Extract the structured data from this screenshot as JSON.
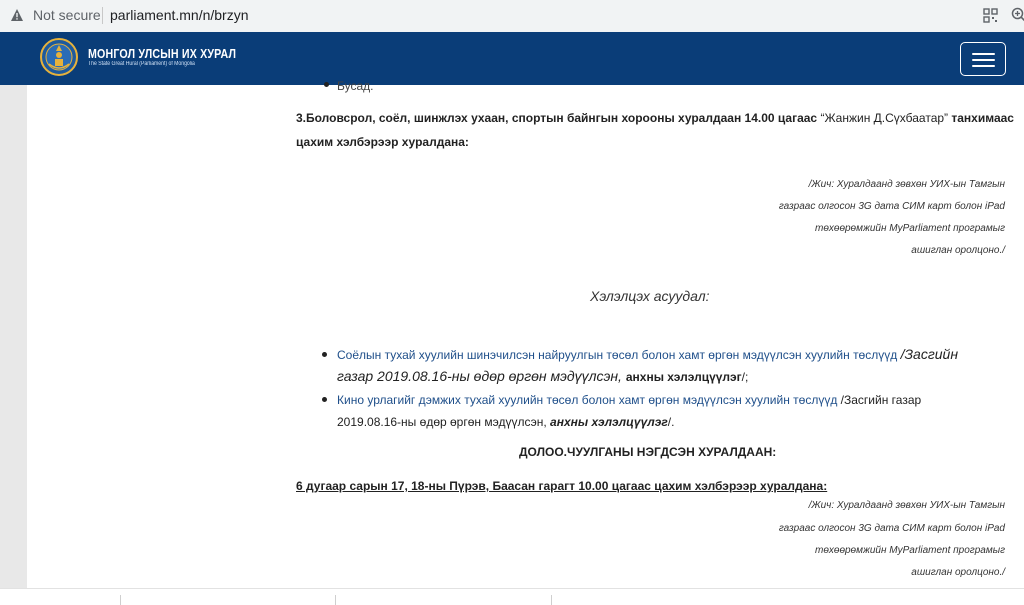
{
  "browser": {
    "security_label": "Not secure",
    "url": "parliament.mn/n/brzyn"
  },
  "header": {
    "brand_name": "МОНГОЛ УЛСЫН ИХ ХУРАЛ",
    "brand_sub": "The State Great Hural (Parliament) of Mongolia"
  },
  "content": {
    "top_bullet": "Бусад.",
    "section3": {
      "line1_bold": "3.Боловсрол, соёл, шинжлэх ухаан, спортын байнгын хорооны хуралдаан 14.00 цагаас ",
      "line1_quote": "“Жанжин Д.Сүхбаатар”",
      "line1_tail": " танхимаас",
      "line2": "цахим хэлбэрээр хуралдана:"
    },
    "note1": [
      "/Жич: Хуралдаанд зөвхөн УИХ-ын Тамгын",
      "газраас олгосон 3G дата СИМ карт болон iPad",
      "төхөөрөмжийн MyParliament програмыг",
      "ашиглан оролцоно./"
    ],
    "questions_title": "Хэлэлцэх асуудал:",
    "questions": [
      {
        "link": "Соёлын тухай хуулийн шинэчилсэн найруулгын төсөл болон хамт өргөн мэдүүлсэн хуулийн төслүүд ",
        "line1_tail": "/Засгийн",
        "line2_italic": "газар 2019.08.16-ны өдөр өргөн мэдүүлсэн, ",
        "line2_bold": "анхны хэлэлцүүлэг",
        "line2_end": "/;"
      },
      {
        "link": "Кино урлагийг дэмжих тухай хуулийн төсөл болон хамт өргөн мэдүүлсэн хуулийн төслүүд ",
        "line1_tail": "/Засгийн газар",
        "line2": "2019.08.16-ны өдөр өргөн мэдүүлсэн, ",
        "line2_bold": "анхны хэлэлцүүлэг",
        "line2_end": "/."
      }
    ],
    "week_heading": "ДОЛОО.ЧУУЛГАНЫ НЭГДСЭН ХУРАЛДААН:",
    "session_line": "6 дугаар сарын 17, 18-ны Пүрэв, Баасан гарагт 10.00 цагаас цахим хэлбэрээр хуралдана:",
    "note2": [
      "/Жич: Хуралдаанд зөвхөн УИХ-ын Тамгын",
      "газраас олгосон 3G дата СИМ карт болон iPad",
      "төхөөрөмжийн MyParliament програмыг",
      "ашиглан оролцоно./"
    ]
  },
  "colors": {
    "header_bg": "#0a3d78",
    "link": "#1f4f8a"
  }
}
